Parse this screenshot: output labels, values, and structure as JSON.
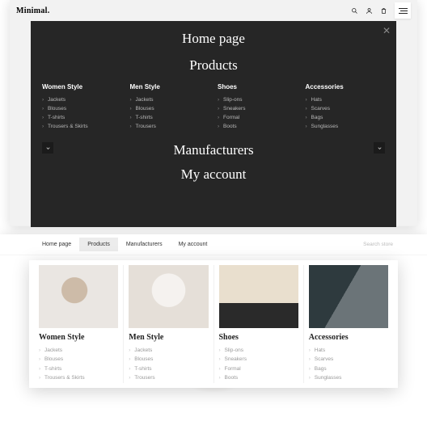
{
  "brand": "Minimal",
  "darkMenu": {
    "t1": "Home page",
    "t2": "Products",
    "t3": "Manufacturers",
    "t4": "My account",
    "columns": [
      {
        "title": "Women Style",
        "items": [
          "Jackets",
          "Blouses",
          "T-shirts",
          "Trousers & Skirts"
        ]
      },
      {
        "title": "Men Style",
        "items": [
          "Jackets",
          "Blouses",
          "T-shirts",
          "Trousers"
        ]
      },
      {
        "title": "Shoes",
        "items": [
          "Slip-ons",
          "Sneakers",
          "Formal",
          "Boots"
        ]
      },
      {
        "title": "Accessories",
        "items": [
          "Hats",
          "Scarves",
          "Bags",
          "Sunglasses"
        ]
      }
    ]
  },
  "hnav": {
    "items": [
      "Home page",
      "Products",
      "Manufacturers",
      "My account"
    ],
    "activeIndex": 1,
    "searchPlaceholder": "Search store"
  },
  "mega": [
    {
      "title": "Women Style",
      "items": [
        "Jackets",
        "Blouses",
        "T-shirts",
        "Trousers & Skirts"
      ]
    },
    {
      "title": "Men Style",
      "items": [
        "Jackets",
        "Blouses",
        "T-shirts",
        "Trousers"
      ]
    },
    {
      "title": "Shoes",
      "items": [
        "Slip-ons",
        "Sneakers",
        "Formal",
        "Boots"
      ]
    },
    {
      "title": "Accessories",
      "items": [
        "Hats",
        "Scarves",
        "Bags",
        "Sunglasses"
      ]
    }
  ]
}
